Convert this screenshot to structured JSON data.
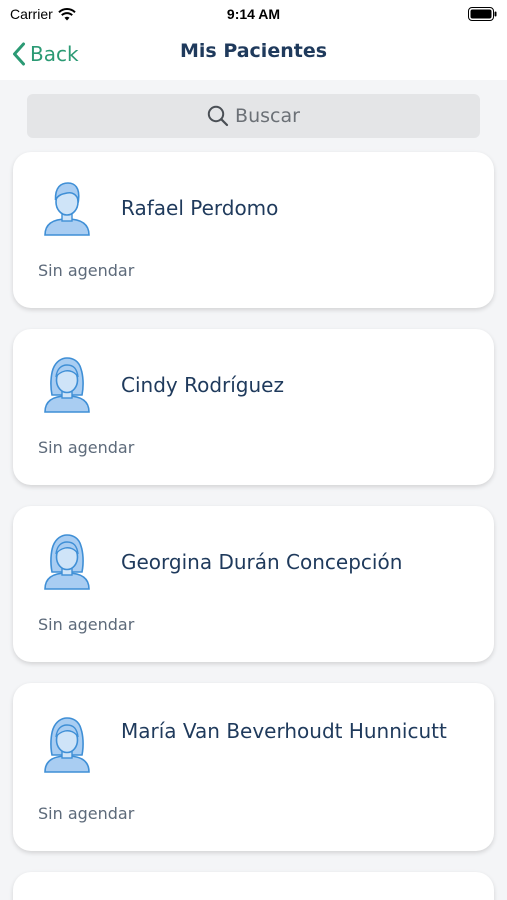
{
  "status_bar": {
    "carrier": "Carrier",
    "time": "9:14 AM"
  },
  "nav": {
    "back_label": "Back",
    "title": "Mis Pacientes"
  },
  "search": {
    "placeholder": "Buscar"
  },
  "patients": [
    {
      "name": "Rafael Perdomo",
      "status": "Sin agendar",
      "avatar": "male-avatar-icon"
    },
    {
      "name": "Cindy Rodríguez",
      "status": "Sin agendar",
      "avatar": "female-avatar-icon"
    },
    {
      "name": "Georgina Durán Concepción",
      "status": "Sin agendar",
      "avatar": "female-avatar-icon"
    },
    {
      "name": "María Van Beverhoudt Hunnicutt",
      "status": "Sin agendar",
      "avatar": "female-avatar-icon"
    }
  ],
  "colors": {
    "accent": "#2b9a74",
    "title": "#1f3a5c",
    "avatar_fill": "#a9cdf2",
    "avatar_stroke": "#3f8fd6"
  }
}
